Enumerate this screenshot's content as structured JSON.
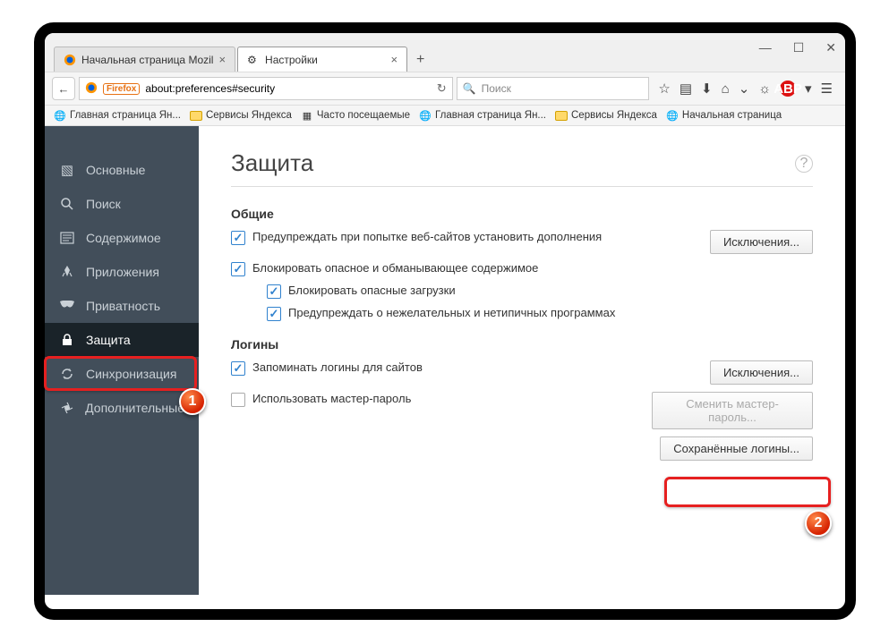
{
  "window": {
    "tabs": [
      {
        "label": "Начальная страница Mozil",
        "active": false
      },
      {
        "label": "Настройки",
        "active": true
      }
    ],
    "url_firefox_badge": "Firefox",
    "url_value": "about:preferences#security",
    "search_placeholder": "Поиск"
  },
  "bookmarks": [
    {
      "label": "Главная страница Ян...",
      "icon": "globe"
    },
    {
      "label": "Сервисы Яндекса",
      "icon": "folder"
    },
    {
      "label": "Часто посещаемые",
      "icon": "thumb"
    },
    {
      "label": "Главная страница Ян...",
      "icon": "globe"
    },
    {
      "label": "Сервисы Яндекса",
      "icon": "folder"
    },
    {
      "label": "Начальная страница",
      "icon": "globe"
    }
  ],
  "sidebar": {
    "items": [
      {
        "label": "Основные",
        "icon": "■"
      },
      {
        "label": "Поиск",
        "icon": "🔍"
      },
      {
        "label": "Содержимое",
        "icon": "≡"
      },
      {
        "label": "Приложения",
        "icon": "🚀"
      },
      {
        "label": "Приватность",
        "icon": "👁"
      },
      {
        "label": "Защита",
        "icon": "🔒",
        "selected": true
      },
      {
        "label": "Синхронизация",
        "icon": "⟳"
      },
      {
        "label": "Дополнительные",
        "icon": "✦"
      }
    ]
  },
  "main": {
    "title": "Защита",
    "sections": {
      "general": {
        "title": "Общие",
        "opt_warn": "Предупреждать при попытке веб-сайтов установить дополнения",
        "opt_block": "Блокировать опасное и обманывающее содержимое",
        "opt_block_dl": "Блокировать опасные загрузки",
        "opt_warn_sw": "Предупреждать о нежелательных и нетипичных программах",
        "btn_exceptions": "Исключения..."
      },
      "logins": {
        "title": "Логины",
        "opt_remember": "Запоминать логины для сайтов",
        "opt_master": "Использовать мастер-пароль",
        "btn_exceptions": "Исключения...",
        "btn_change_master": "Сменить мастер-пароль...",
        "btn_saved": "Сохранённые логины..."
      }
    }
  },
  "annotations": {
    "badge1": "1",
    "badge2": "2"
  }
}
